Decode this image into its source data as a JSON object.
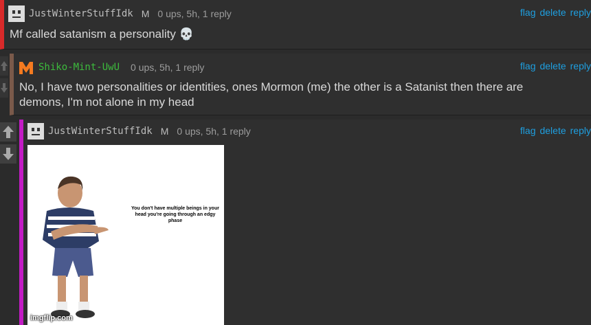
{
  "comments": [
    {
      "username": "JustWinterStuffIdk",
      "mod": "M",
      "meta": "0 ups, 5h, 1 reply",
      "text": "Mf called satanism a personality 💀",
      "actions": {
        "flag": "flag",
        "delete": "delete",
        "reply": "reply"
      },
      "accent_color": "#d92a2a"
    },
    {
      "username": "Shiko-Mint-UwU",
      "mod": "",
      "meta": "0 ups, 5h, 1 reply",
      "text_line1": "No, I have two personalities or identities, ones Mormon (me) the other is a Satanist then there are",
      "text_line2": "demons, I'm not alone in my head",
      "actions": {
        "flag": "flag",
        "delete": "delete",
        "reply": "reply"
      },
      "accent_color": "#7a5a4a"
    },
    {
      "username": "JustWinterStuffIdk",
      "mod": "M",
      "meta": "0 ups, 5h, 1 reply",
      "actions": {
        "flag": "flag",
        "delete": "delete",
        "reply": "reply"
      },
      "accent_color": "#c21bc4",
      "image": {
        "caption": "You don't have multiple beings in your head you're going through an edgy phase",
        "watermark": "imgflip.com"
      }
    }
  ],
  "icons": {
    "upvote": "arrow-up-icon",
    "downvote": "arrow-down-icon",
    "skull": "skull-emoji"
  }
}
